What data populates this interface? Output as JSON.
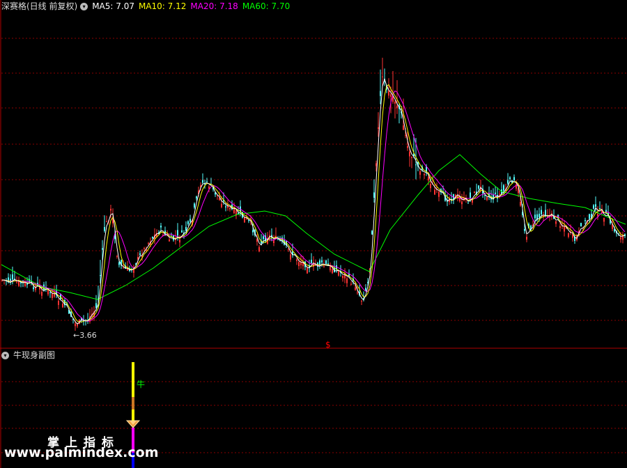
{
  "header": {
    "stock_name": "深赛格(日线 前复权)",
    "ma5": "MA5: 7.07",
    "ma10": "MA10: 7.12",
    "ma20": "MA20: 7.18",
    "ma60": "MA60: 7.70",
    "colors": {
      "ma5": "#ffffff",
      "ma10": "#ffff00",
      "ma20": "#ff00ff",
      "ma60": "#00ff00"
    }
  },
  "main_chart": {
    "low_label": "←3.66",
    "signal_marker": "$",
    "colors": {
      "up": "#ff3333",
      "down": "#54ffff",
      "grid": "#8b0000",
      "signal": "#ff0000"
    }
  },
  "sub_chart": {
    "title": "牛现身副图",
    "bull_label": "牛",
    "bar_colors": [
      "#ffff00",
      "#cc7722",
      "#ffff00",
      "#ff00ff",
      "#0000ff"
    ],
    "marker_icon": "diamond-icon"
  },
  "watermark": {
    "cn": "掌上指标",
    "url": "www.palmindex.com"
  }
}
